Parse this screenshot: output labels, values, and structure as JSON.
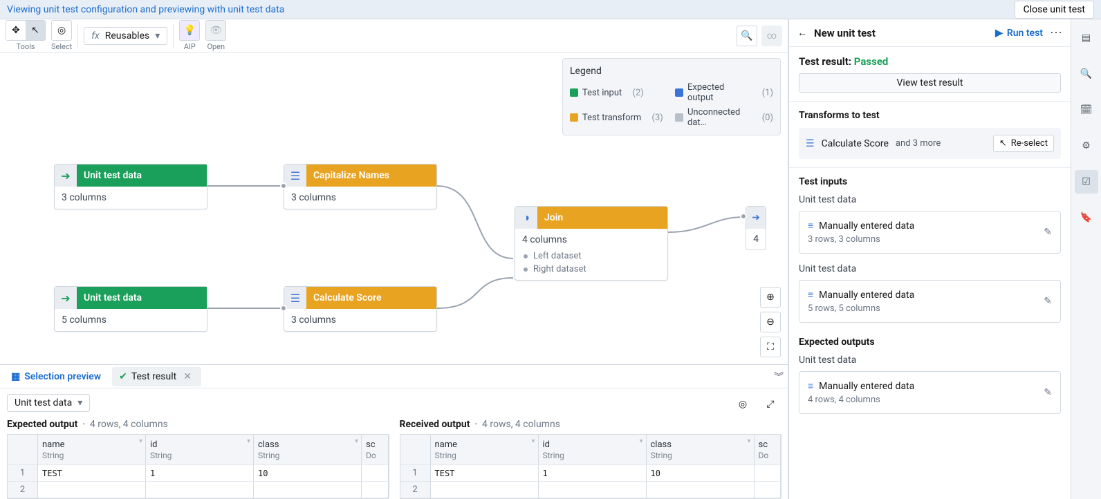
{
  "topbar": {
    "text": "Viewing unit test configuration and previewing with unit test data",
    "close": "Close unit test"
  },
  "toolbar": {
    "tools": "Tools",
    "select": "Select",
    "reusables": "Reusables",
    "aip": "AIP",
    "open": "Open"
  },
  "legend": {
    "title": "Legend",
    "items": [
      {
        "label": "Test input",
        "count": "(2)",
        "color": "#1aa05a"
      },
      {
        "label": "Expected output",
        "count": "(1)",
        "color": "#3b74d8"
      },
      {
        "label": "Test transform",
        "count": "(3)",
        "color": "#e8a321"
      },
      {
        "label": "Unconnected dat…",
        "count": "(0)",
        "color": "#b7bfc9"
      }
    ]
  },
  "nodes": {
    "in1": {
      "title": "Unit test data",
      "sub": "3 columns"
    },
    "in2": {
      "title": "Unit test data",
      "sub": "5 columns"
    },
    "t1": {
      "title": "Capitalize Names",
      "sub": "3 columns"
    },
    "t2": {
      "title": "Calculate Score",
      "sub": "3 columns"
    },
    "join": {
      "title": "Join",
      "sub": "4 columns",
      "left": "Left dataset",
      "right": "Right dataset"
    },
    "out": {
      "sub": "4"
    }
  },
  "bottom": {
    "tab1": "Selection preview",
    "tab2": "Test result",
    "dropdown": "Unit test data",
    "exp": {
      "title": "Expected output",
      "meta": "4 rows, 4 columns"
    },
    "rec": {
      "title": "Received output",
      "meta": "4 rows, 4 columns"
    },
    "cols": [
      {
        "name": "name",
        "type": "String"
      },
      {
        "name": "id",
        "type": "String"
      },
      {
        "name": "class",
        "type": "String"
      },
      {
        "name": "sc",
        "type": "Do"
      }
    ],
    "row1": [
      "TEST",
      "1",
      "10",
      ""
    ],
    "idx1": "1",
    "idx2": "2"
  },
  "side": {
    "title": "New unit test",
    "run": "Run test",
    "result_label": "Test result: ",
    "result_value": "Passed",
    "view": "View test result",
    "transforms_h": "Transforms to test",
    "trans_name": "Calculate Score",
    "trans_more": "and 3 more",
    "reselect": "Re-select",
    "inputs_h": "Test inputs",
    "in_label": "Unit test data",
    "manual": "Manually entered data",
    "in1_sub": "3 rows, 3 columns",
    "in2_sub": "5 rows, 5 columns",
    "outputs_h": "Expected outputs",
    "out_sub": "4 rows, 4 columns"
  }
}
